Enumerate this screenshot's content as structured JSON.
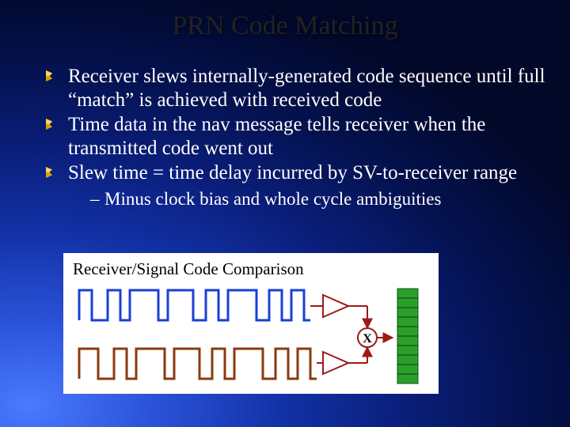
{
  "title": "PRN Code Matching",
  "bullets": {
    "b1": "Receiver slews internally-generated code sequence until full “match” is achieved with received code",
    "b2": "Time data in the nav message tells receiver when the transmitted code went out",
    "b3": "Slew time = time delay incurred by SV-to-receiver range",
    "sub1": "Minus clock bias and whole cycle ambiguities"
  },
  "figure": {
    "title": "Receiver/Signal Code Comparison",
    "mult_label": "X"
  }
}
